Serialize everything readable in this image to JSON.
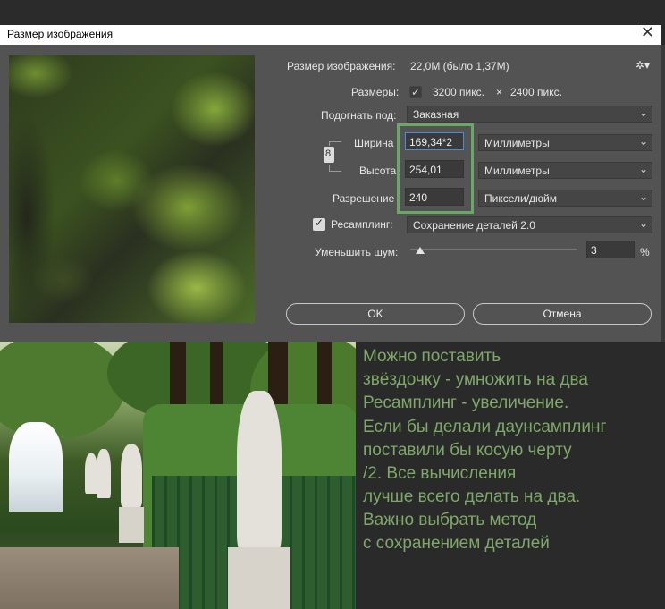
{
  "window": {
    "title": "Размер изображения"
  },
  "dialog": {
    "image_size_label": "Размер изображения:",
    "image_size_value": "22,0M (было 1,37M)",
    "dimensions_label": "Размеры:",
    "dimensions_w": "3200 пикс.",
    "dimensions_x": "×",
    "dimensions_h": "2400 пикс.",
    "fit_label": "Подогнать под:",
    "fit_value": "Заказная",
    "width_label": "Ширина",
    "width_value": "169,34*2",
    "width_unit": "Миллиметры",
    "height_label": "Высота",
    "height_value": "254,01",
    "height_unit": "Миллиметры",
    "resolution_label": "Разрешение",
    "resolution_value": "240",
    "resolution_unit": "Пиксели/дюйм",
    "resample_label": "Ресамплинг:",
    "resample_checked": true,
    "resample_value": "Сохранение деталей 2.0",
    "noise_label": "Уменьшить шум:",
    "noise_value": "3",
    "noise_level_percent": 3,
    "noise_unit": "%",
    "ok_label": "OK",
    "cancel_label": "Отмена"
  },
  "notes": {
    "lines": [
      "Можно поставить",
      "звёздочку - умножить на два",
      "Ресамплинг - увеличение.",
      "Если бы делали даунсамплинг",
      "поставили бы косую черту",
      "/2. Все вычисления",
      "лучше всего делать на два.",
      "Важно выбрать метод",
      "с сохранением деталей"
    ]
  },
  "colors": {
    "dialog_bg": "#535353",
    "highlight_box": "#6aa868",
    "note_text": "#7ea86a",
    "active_field_border": "#4b8be0"
  }
}
